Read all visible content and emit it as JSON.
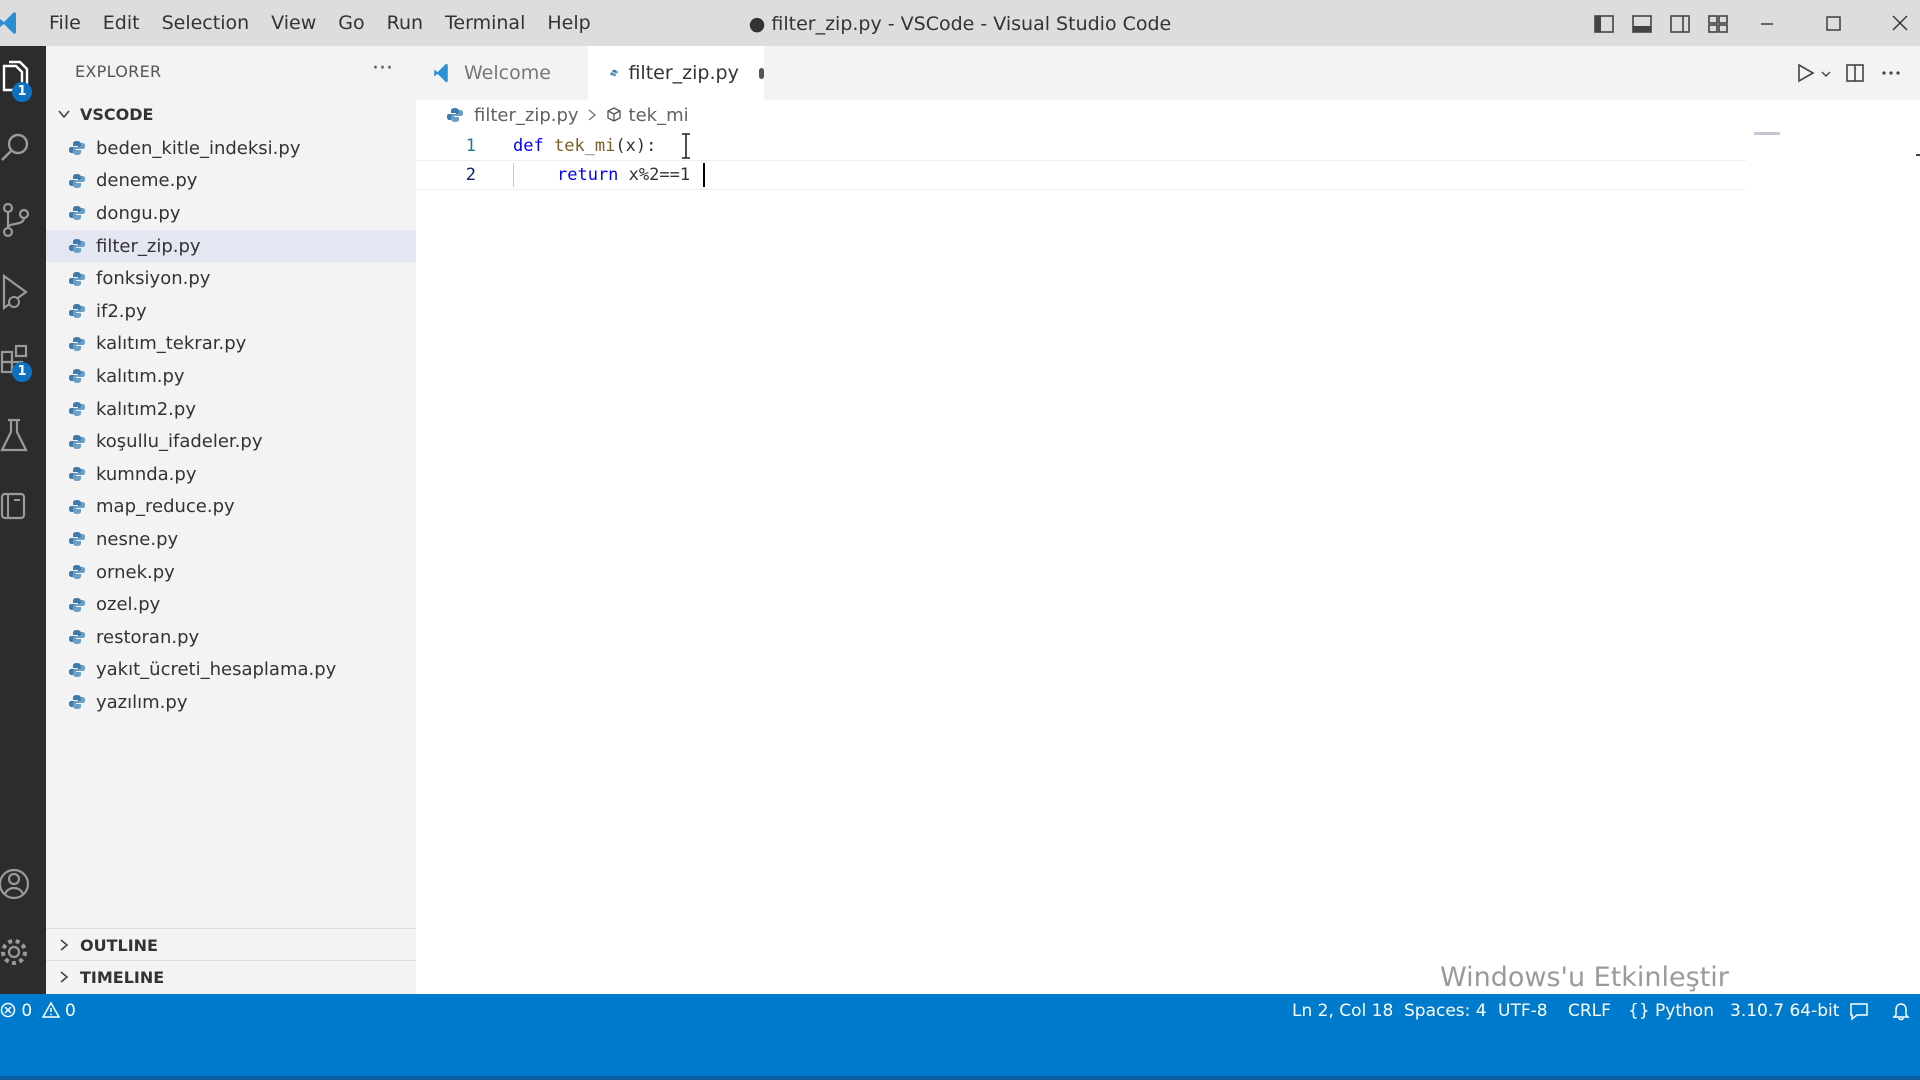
{
  "titlebar": {
    "menus": [
      "File",
      "Edit",
      "Selection",
      "View",
      "Go",
      "Run",
      "Terminal",
      "Help"
    ],
    "window_title": "● filter_zip.py - VSCode - Visual Studio Code"
  },
  "activitybar": {
    "explorer_badge": "1",
    "extensions_badge": "1"
  },
  "sidebar": {
    "title": "EXPLORER",
    "more": "···",
    "folder": "VSCODE",
    "files": [
      "beden_kitle_indeksi.py",
      "deneme.py",
      "dongu.py",
      "filter_zip.py",
      "fonksiyon.py",
      "if2.py",
      "kalıtım_tekrar.py",
      "kalıtım.py",
      "kalıtım2.py",
      "koşullu_ifadeler.py",
      "kumnda.py",
      "map_reduce.py",
      "nesne.py",
      "ornek.py",
      "ozel.py",
      "restoran.py",
      "yakıt_ücreti_hesaplama.py",
      "yazılım.py"
    ],
    "outline_label": "OUTLINE",
    "timeline_label": "TIMELINE"
  },
  "tabs": {
    "welcome": "Welcome",
    "active": "filter_zip.py"
  },
  "breadcrumb": {
    "file": "filter_zip.py",
    "symbol": "tek_mi"
  },
  "editor": {
    "lines": [
      {
        "num": "1",
        "kw": "def",
        "fn": "tek_mi",
        "rest": "(x):"
      },
      {
        "num": "2",
        "kw": "return",
        "rest": "x%2==1"
      }
    ]
  },
  "watermark": "Windows'u Etkinleştir",
  "statusbar": {
    "errors": "0",
    "warnings": "0",
    "position": "Ln 2, Col 18",
    "spaces": "Spaces: 4",
    "encoding": "UTF-8",
    "eol": "CRLF",
    "language": "Python",
    "interpreter": "3.10.7 64-bit"
  },
  "colors": {
    "accent": "#007acc",
    "keyword": "#0000ff",
    "function": "#795e26",
    "python_icon": "#3e7aab"
  }
}
